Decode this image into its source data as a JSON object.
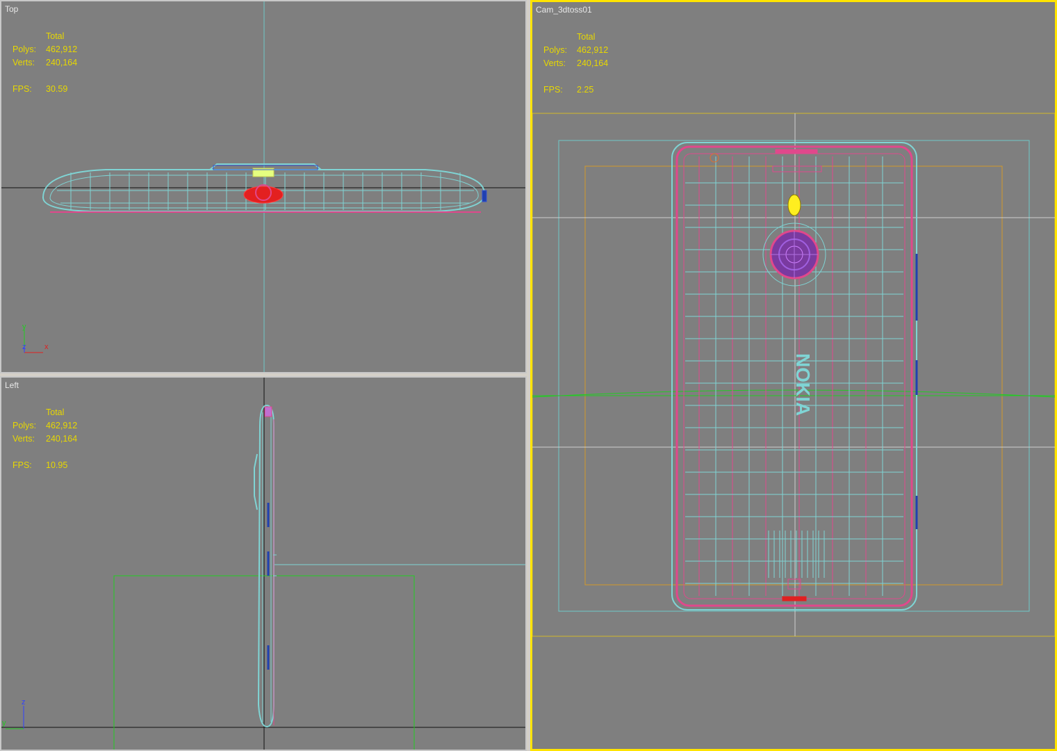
{
  "viewports": {
    "top": {
      "label": "Top",
      "stats": {
        "header": "Total",
        "polys_label": "Polys:",
        "polys": "462,912",
        "verts_label": "Verts:",
        "verts": "240,164",
        "fps_label": "FPS:",
        "fps": "30.59"
      },
      "axis": {
        "a": "y",
        "b": "z",
        "c": "x"
      }
    },
    "left": {
      "label": "Left",
      "stats": {
        "header": "Total",
        "polys_label": "Polys:",
        "polys": "462,912",
        "verts_label": "Verts:",
        "verts": "240,164",
        "fps_label": "FPS:",
        "fps": "10.95"
      },
      "axis": {
        "a": "z",
        "b": "y"
      }
    },
    "camera": {
      "label": "Cam_3dtoss01",
      "stats": {
        "header": "Total",
        "polys_label": "Polys:",
        "polys": "462,912",
        "verts_label": "Verts:",
        "verts": "240,164",
        "fps_label": "FPS:",
        "fps": "2.25"
      }
    }
  },
  "colors": {
    "viewport_bg": "#7f7f7f",
    "active_border": "#ffe400",
    "stats_text": "#e8d800",
    "wire_cyan": "#7fd4d4",
    "wire_pink": "#e0488c",
    "safe_frame_orange": "#d39a2a",
    "grid_green": "#22cc22"
  }
}
